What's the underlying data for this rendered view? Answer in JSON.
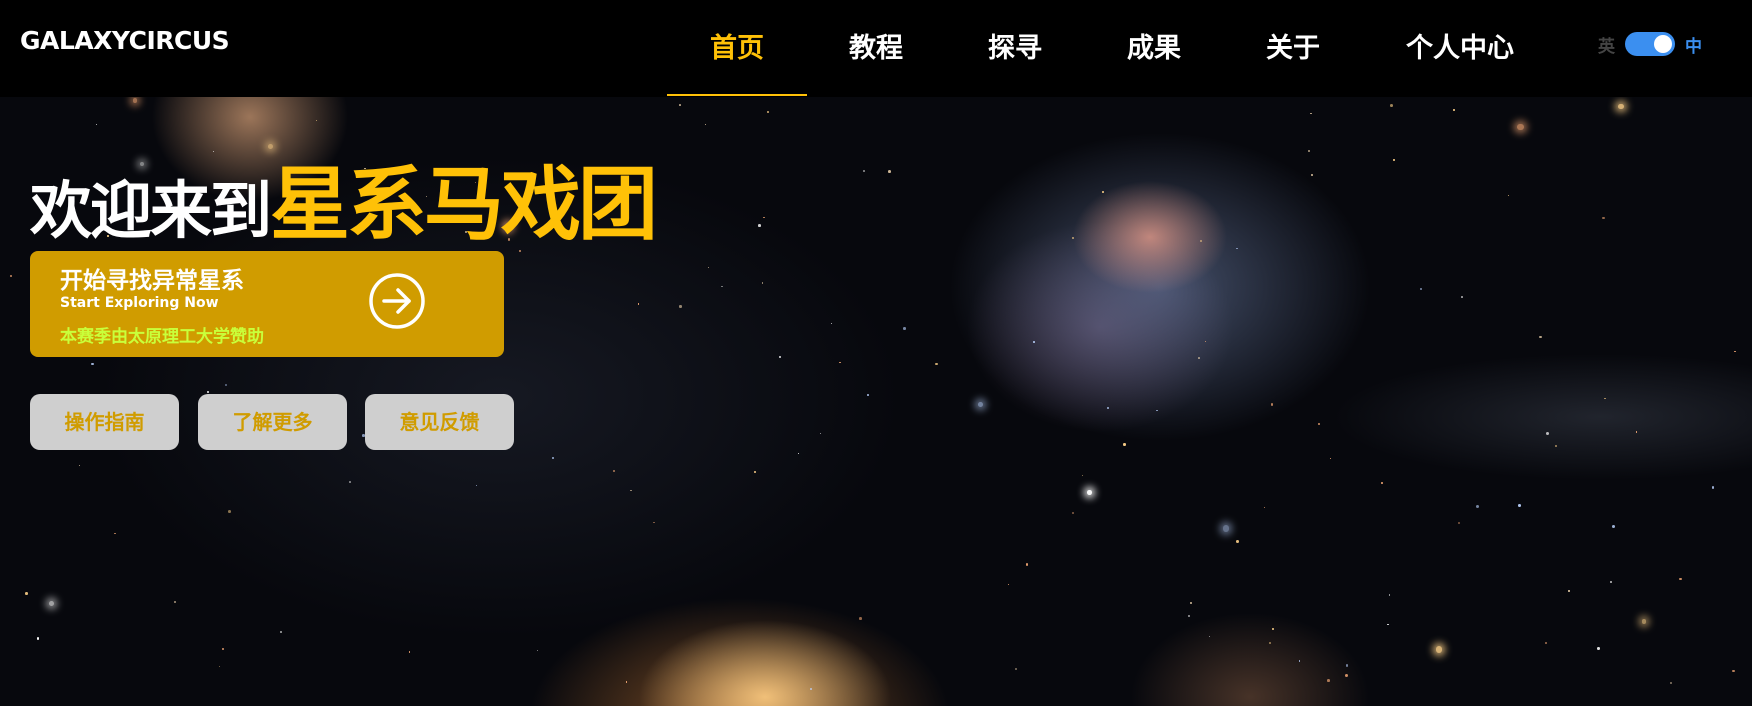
{
  "nav": {
    "logo": "GALAXYCIRCUS",
    "items": [
      {
        "label": "首页",
        "active": true
      },
      {
        "label": "教程",
        "active": false
      },
      {
        "label": "探寻",
        "active": false
      },
      {
        "label": "成果",
        "active": false
      },
      {
        "label": "关于",
        "active": false
      },
      {
        "label": "个人中心",
        "active": false
      }
    ],
    "lang_toggle": {
      "left_label": "英",
      "right_label": "中",
      "state": "中"
    }
  },
  "hero": {
    "headline_prefix": "欢迎来到",
    "headline_highlight": "星系马戏团",
    "cta": {
      "title": "开始寻找异常星系",
      "subtitle": "Start Exploring Now",
      "sponsor": "本赛季由太原理工大学赞助",
      "icon": "arrow-right-circle-icon"
    },
    "buttons": [
      {
        "label": "操作指南"
      },
      {
        "label": "了解更多"
      },
      {
        "label": "意见反馈"
      }
    ],
    "background_image": "galaxy-group-space-photo"
  },
  "colors": {
    "accent": "#ffc107",
    "cta_bg": "#d09c00",
    "sponsor_text": "#c9ff3a",
    "toggle": "#3b8ff0",
    "secondary_button_bg": "#cfcfcf"
  }
}
